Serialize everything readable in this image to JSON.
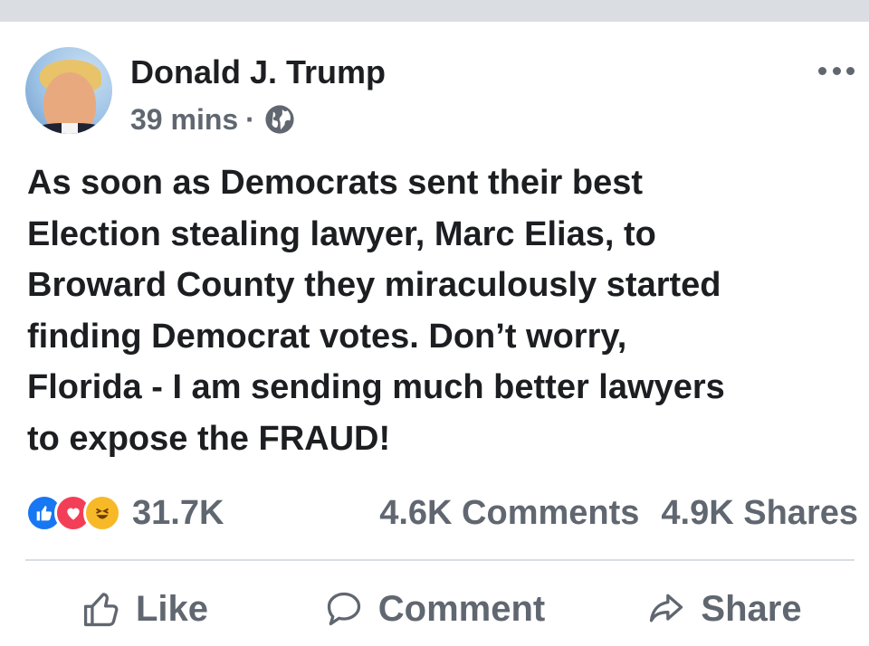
{
  "post": {
    "author": "Donald J. Trump",
    "time": "39 mins",
    "separator": "·",
    "audience_icon": "globe-icon",
    "menu_icon": "more-options-icon",
    "text": "As soon as Democrats sent their best\nElection stealing lawyer, Marc Elias, to\nBroward County they miraculously started\nfinding Democrat votes. Don’t worry,\nFlorida - I am sending much better lawyers\nto expose the FRAUD!"
  },
  "stats": {
    "reaction_icons": [
      "like-reaction-icon",
      "love-reaction-icon",
      "haha-reaction-icon"
    ],
    "reactions": "31.7K",
    "comments": "4.6K Comments",
    "shares": "4.9K Shares"
  },
  "actions": {
    "like": "Like",
    "comment": "Comment",
    "share": "Share"
  },
  "colors": {
    "text": "#1c1e21",
    "secondary": "#606770",
    "like_blue": "#1877f2",
    "love_red": "#f33e58",
    "haha_yellow": "#f7b928"
  }
}
